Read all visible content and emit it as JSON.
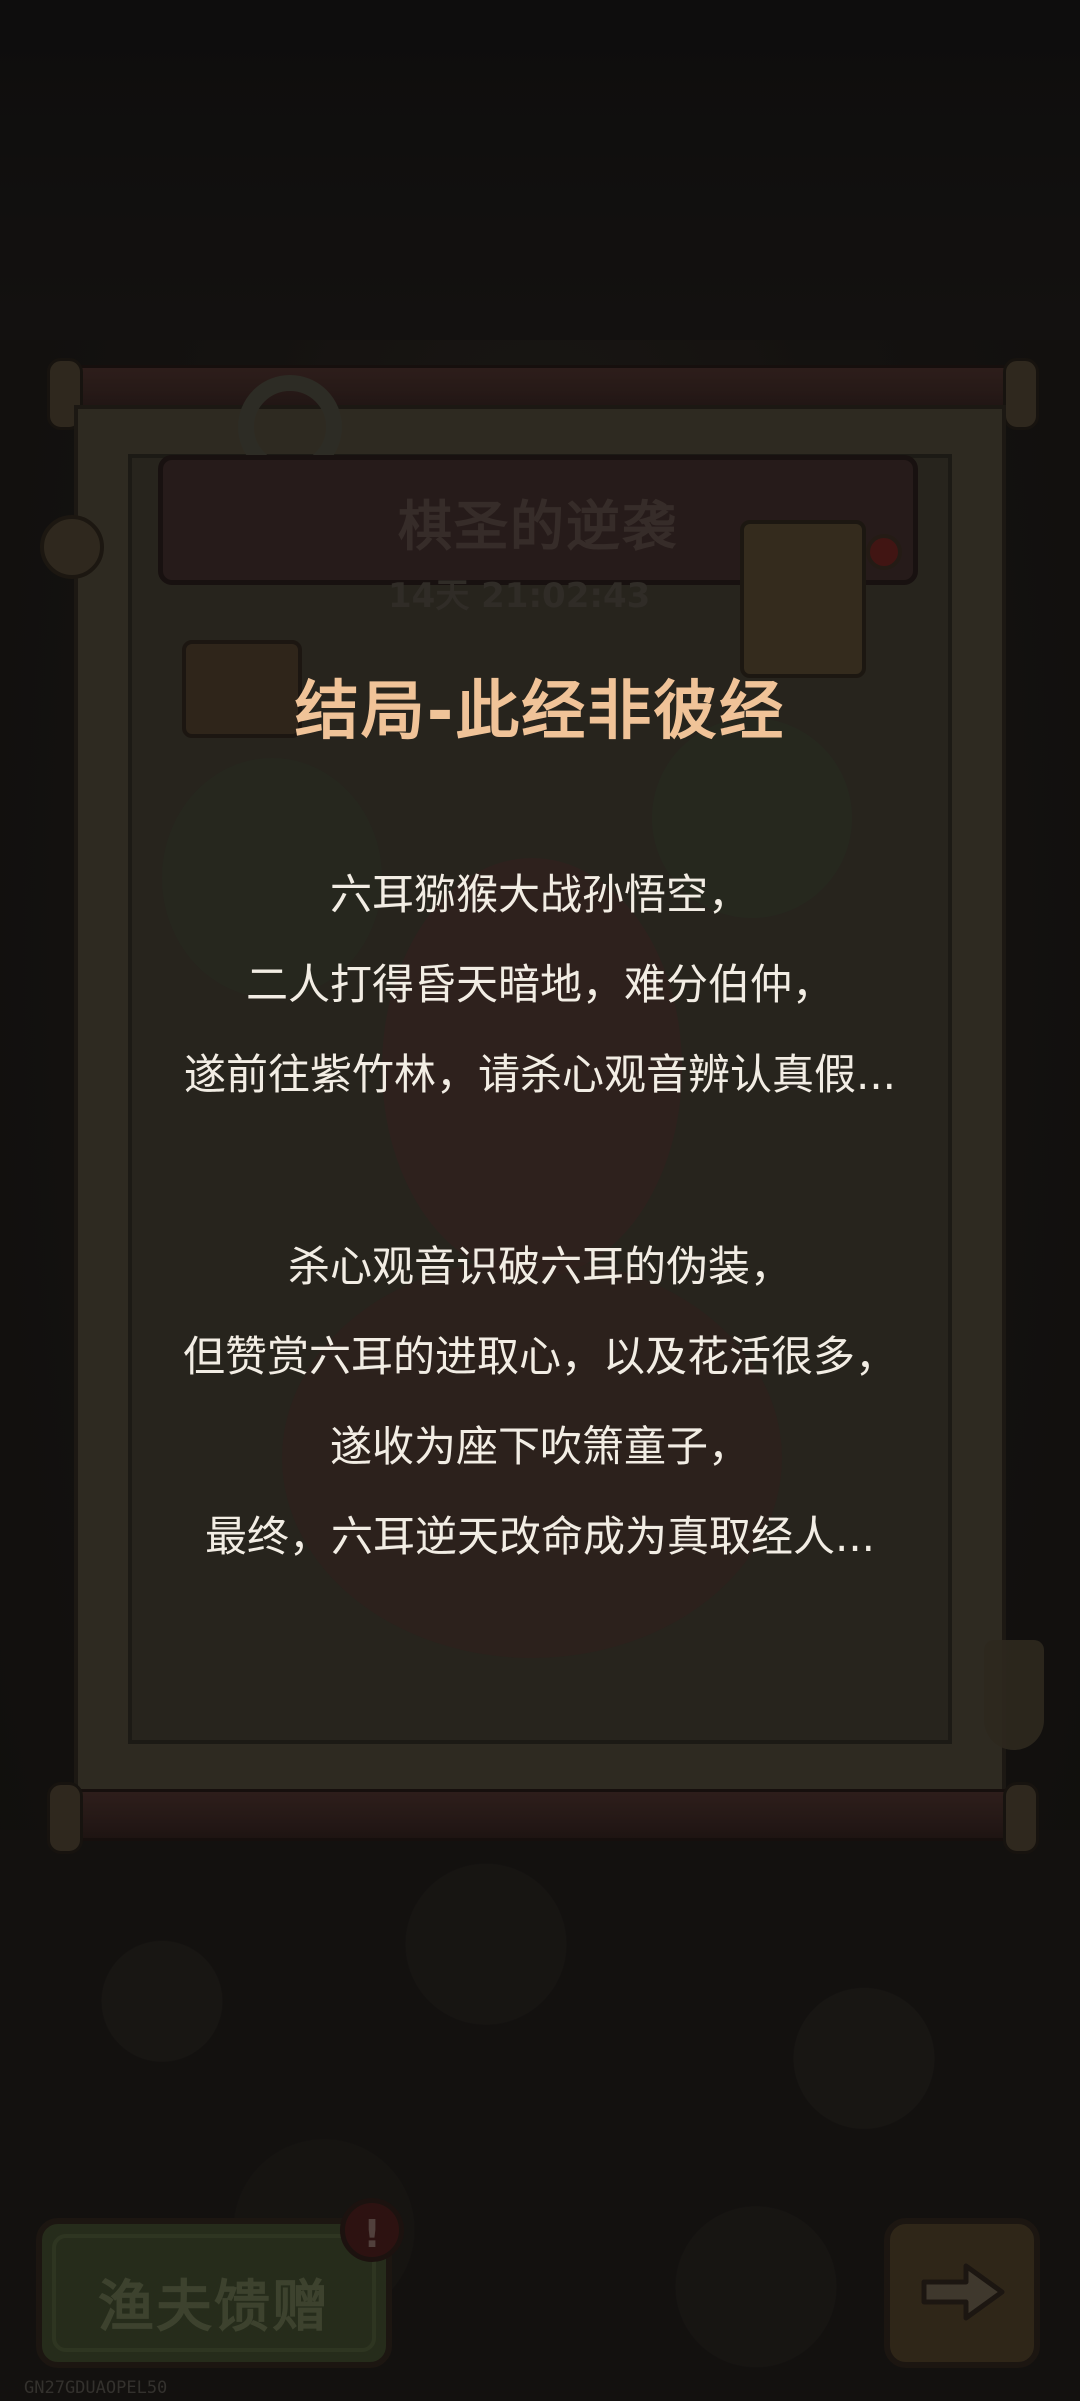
{
  "event_panel": {
    "title": "棋圣的逆袭",
    "timer": "14天 21:02:43"
  },
  "ending": {
    "title": "结局-此经非彼经",
    "paragraph1": [
      "六耳猕猴大战孙悟空，",
      "二人打得昏天暗地，难分伯仲，",
      "遂前往紫竹林，请杀心观音辨认真假..."
    ],
    "paragraph2": [
      "杀心观音识破六耳的伪装，",
      "但赞赏六耳的进取心，以及花活很多，",
      "遂收为座下吹箫童子，",
      "最终，六耳逆天改命成为真取经人..."
    ]
  },
  "buttons": {
    "fisher_gift": "渔夫馈赠",
    "fisher_alert": "!",
    "next_icon": "arrow-right-icon"
  },
  "watermark": "GN27GDUAOPEL50",
  "colors": {
    "ending_title": "#f0c398",
    "ending_text": "#f2ede4"
  }
}
